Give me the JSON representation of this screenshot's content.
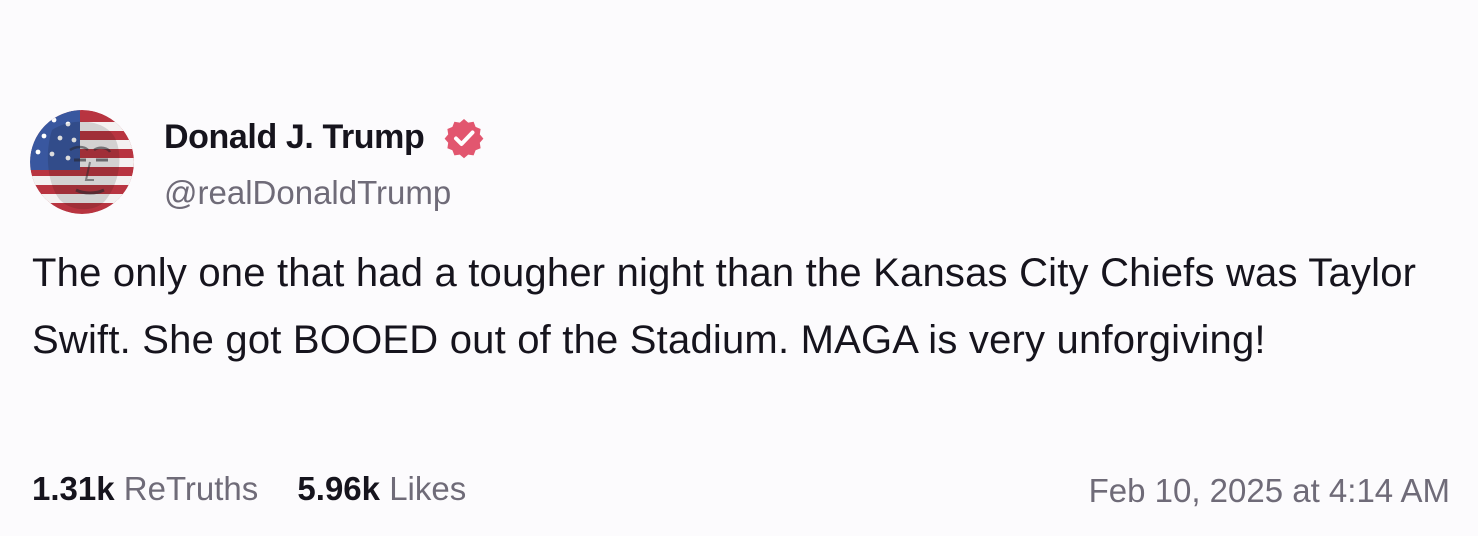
{
  "account": {
    "display_name": "Donald J. Trump",
    "handle": "@realDonaldTrump",
    "verified": true,
    "verified_badge_color": "#e2566f"
  },
  "post": {
    "text": "The only one that had a tougher night than the Kansas City Chiefs was Taylor Swift. She got BOOED out of the Stadium. MAGA is very unforgiving!",
    "timestamp": "Feb 10, 2025 at 4:14 AM"
  },
  "stats": {
    "retruths_count": "1.31k",
    "retruths_label": "ReTruths",
    "likes_count": "5.96k",
    "likes_label": "Likes"
  },
  "colors": {
    "background": "#fcfbfd",
    "text_primary": "#16141d",
    "text_secondary": "#6f6b78"
  },
  "icons": {
    "verified": "verified-badge-icon",
    "avatar": "flag-portrait-avatar"
  }
}
